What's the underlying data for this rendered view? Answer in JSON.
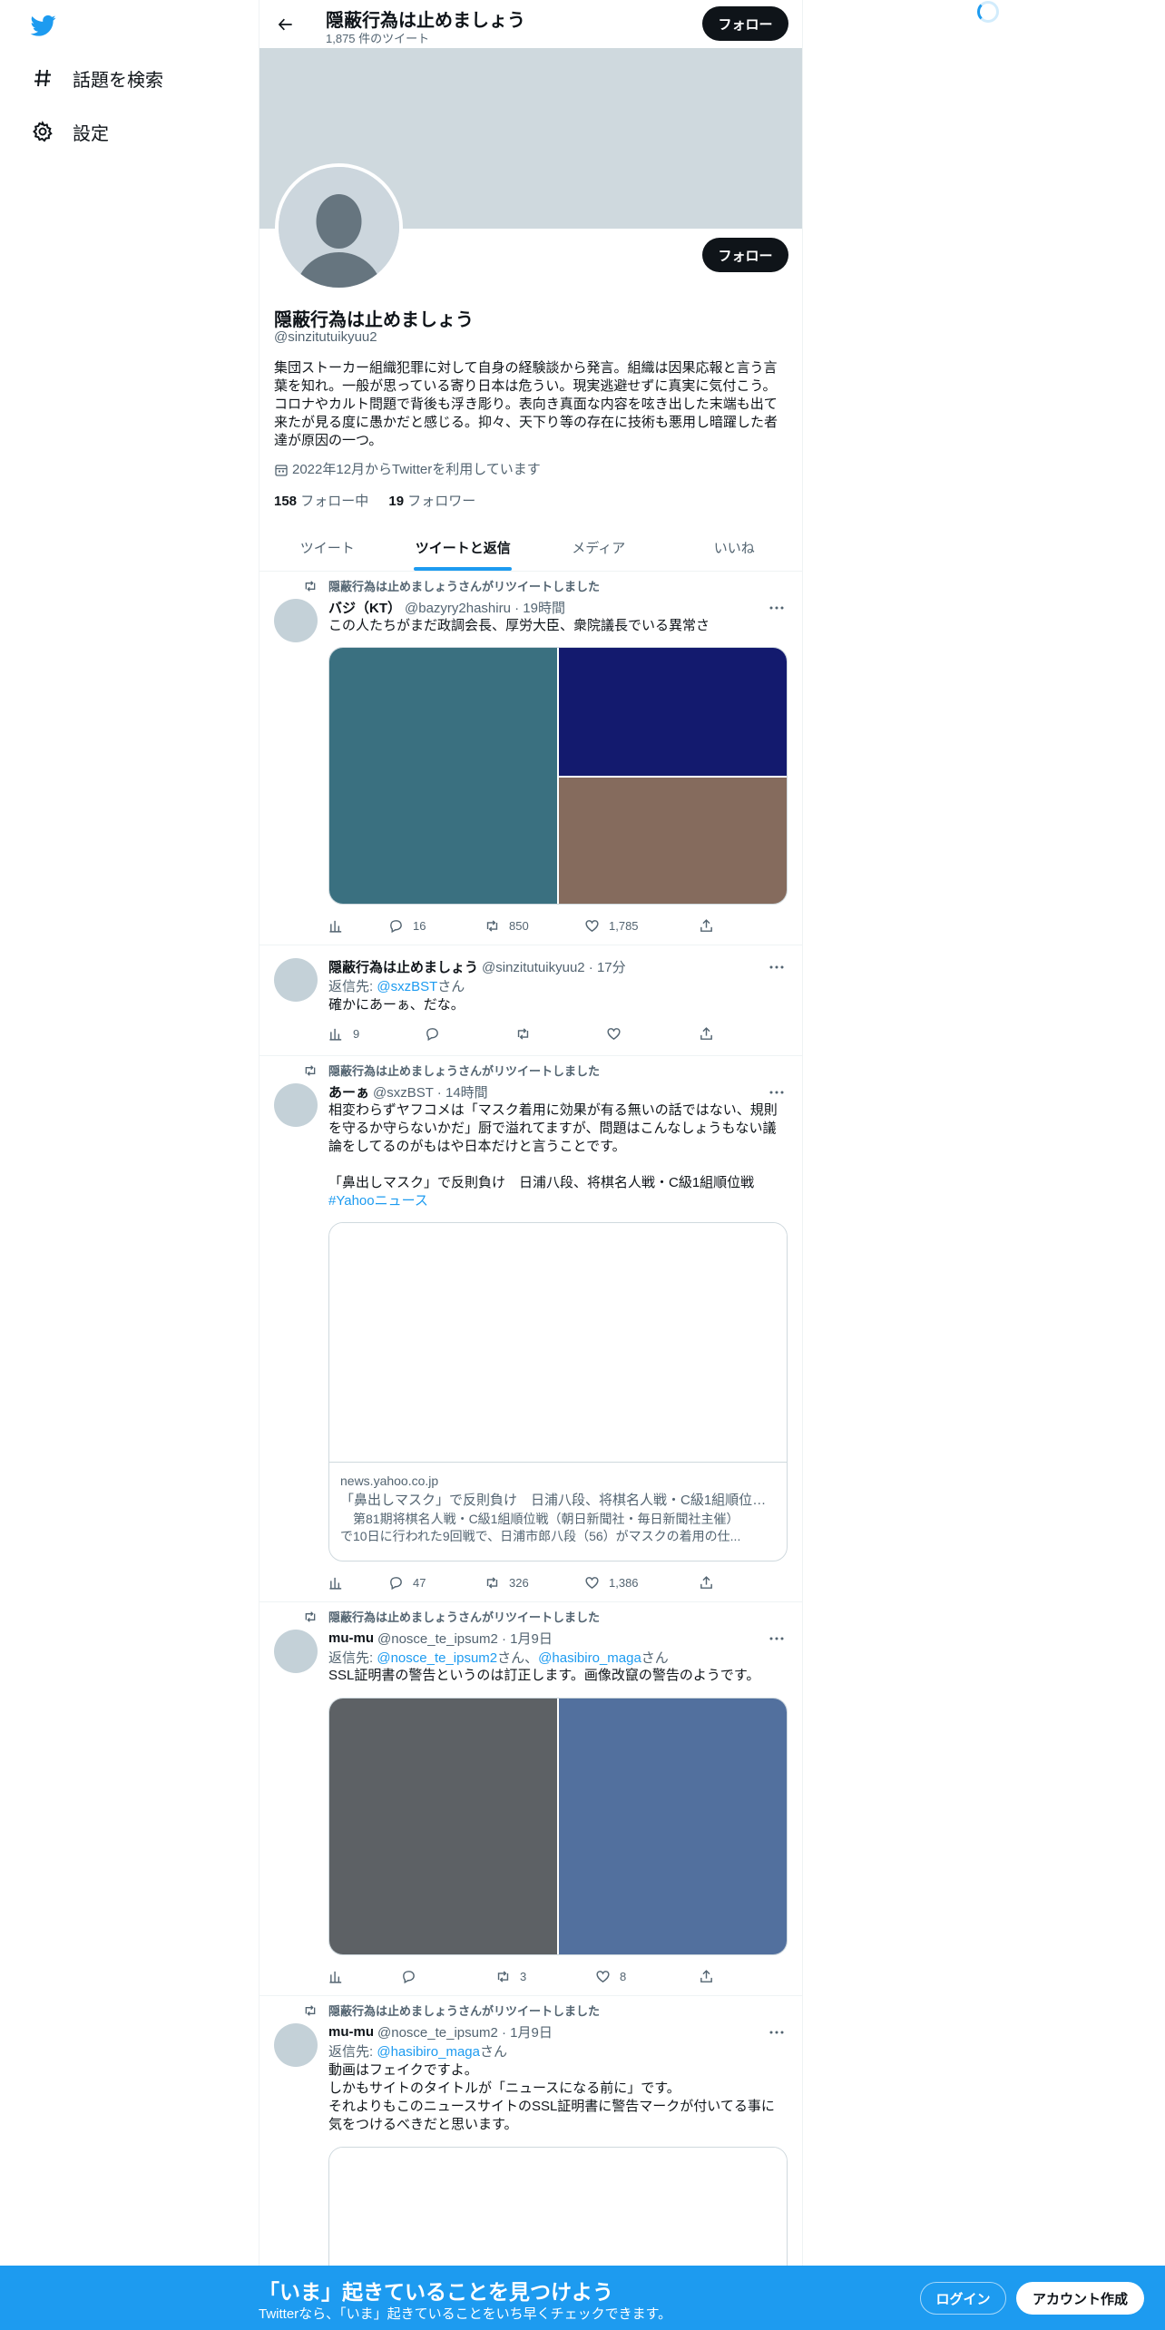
{
  "nav": {
    "items": [
      {
        "label": "話題を検索",
        "icon": "hashtag-icon"
      },
      {
        "label": "設定",
        "icon": "gear-icon"
      }
    ]
  },
  "header": {
    "title": "隠蔽行為は止めましょう",
    "tweet_count": "1,875 件のツイート",
    "follow_label": "フォロー"
  },
  "profile": {
    "name": "隠蔽行為は止めましょう",
    "handle": "@sinzitutuikyuu2",
    "follow_label": "フォロー",
    "bio": "集団ストーカー組織犯罪に対して自身の経験談から発言。組織は因果応報と言う言\n葉を知れ。一般が思っている寄り日本は危うい。現実逃避せずに真実に気付こう。\nコロナやカルト問題で背後も浮き彫り。表向き真面な内容を呟き出した末端も出て\n来たが見る度に愚かだと感じる。抑々、天下り等の存在に技術も悪用し暗躍した者\n達が原因の一つ。",
    "joined": "2022年12月からTwitterを利用しています",
    "following_count": "158",
    "following_label": "フォロー中",
    "followers_count": "19",
    "followers_label": "フォロワー"
  },
  "tabs": [
    {
      "label": "ツイート"
    },
    {
      "label": "ツイートと返信"
    },
    {
      "label": "メディア"
    },
    {
      "label": "いいね"
    }
  ],
  "tweets": [
    {
      "retweet_label": "隠蔽行為は止めましょうさんがリツイートしました",
      "name": "バジ（KT）",
      "handle": "@bazyry2hashiru · 19時間",
      "text": "この人たちがまだ政調会長、厚労大臣、衆院議長でいる異常さ",
      "media_colors": [
        "#3a7080",
        "#131a6e",
        "#856b5d"
      ],
      "stats": {
        "views": "",
        "replies": "16",
        "retweets": "850",
        "likes": "1,785"
      }
    },
    {
      "name": "隠蔽行為は止めましょう",
      "handle": "@sinzitutuikyuu2 · 17分",
      "reply_prefix": "返信先: ",
      "reply_to": "@sxzBST",
      "reply_suffix": "さん",
      "text": "確かにあーぁ、だな。",
      "stats": {
        "views": "9",
        "replies": "",
        "retweets": "",
        "likes": ""
      }
    },
    {
      "retweet_label": "隠蔽行為は止めましょうさんがリツイートしました",
      "name": "あーぁ",
      "handle": "@sxzBST · 14時間",
      "text": "相変わらずヤフコメは「マスク着用に効果が有る無いの話ではない、規則\nを守るか守らないかだ」厨で溢れてますが、問題はこんなしょうもない議\n論をしてるのがもはや日本だけと言うことです。\n\n「鼻出しマスク」で反則負け　日浦八段、将棋名人戦・C級1組順位戦",
      "hashtag": "#Yahooニュース",
      "card": {
        "domain": "news.yahoo.co.jp",
        "title": "「鼻出しマスク」で反則負け　日浦八段、将棋名人戦・C級1組順位戦...",
        "desc": "　第81期将棋名人戦・C級1組順位戦（朝日新聞社・毎日新聞社主催）\nで10日に行われた9回戦で、日浦市郎八段（56）がマスクの着用の仕..."
      },
      "stats": {
        "views": "",
        "replies": "47",
        "retweets": "326",
        "likes": "1,386"
      }
    },
    {
      "retweet_label": "隠蔽行為は止めましょうさんがリツイートしました",
      "name": "mu-mu",
      "handle": "@nosce_te_ipsum2 · 1月9日",
      "reply_prefix": "返信先: ",
      "reply_to": "@nosce_te_ipsum2",
      "reply_mid": "さん、",
      "reply_to2": "@hasibiro_maga",
      "reply_suffix": "さん",
      "text": "SSL証明書の警告というのは訂正します。画像改竄の警告のようです。",
      "media_colors": [
        "#5d6165",
        "#52709e"
      ],
      "stats": {
        "views": "",
        "replies": "",
        "retweets": "3",
        "likes": "8"
      }
    },
    {
      "retweet_label": "隠蔽行為は止めましょうさんがリツイートしました",
      "name": "mu-mu",
      "handle": "@nosce_te_ipsum2 · 1月9日",
      "reply_prefix": "返信先: ",
      "reply_to": "@hasibiro_maga",
      "reply_suffix": "さん",
      "text": "動画はフェイクですよ。\nしかもサイトのタイトルが「ニュースになる前に」です。\nそれよりもこのニュースサイトのSSL証明書に警告マークが付いてる事に\n気をつけるべきだと思います。"
    }
  ],
  "bottom_bar": {
    "title": "「いま」起きていることを見つけよう",
    "subtitle": "Twitterなら、「いま」起きていることをいち早くチェックできます。",
    "login_label": "ログイン",
    "signup_label": "アカウント作成"
  },
  "colors": {
    "accent": "#1d9bf0",
    "banner": "#cfd9de",
    "text_secondary": "#536471"
  }
}
